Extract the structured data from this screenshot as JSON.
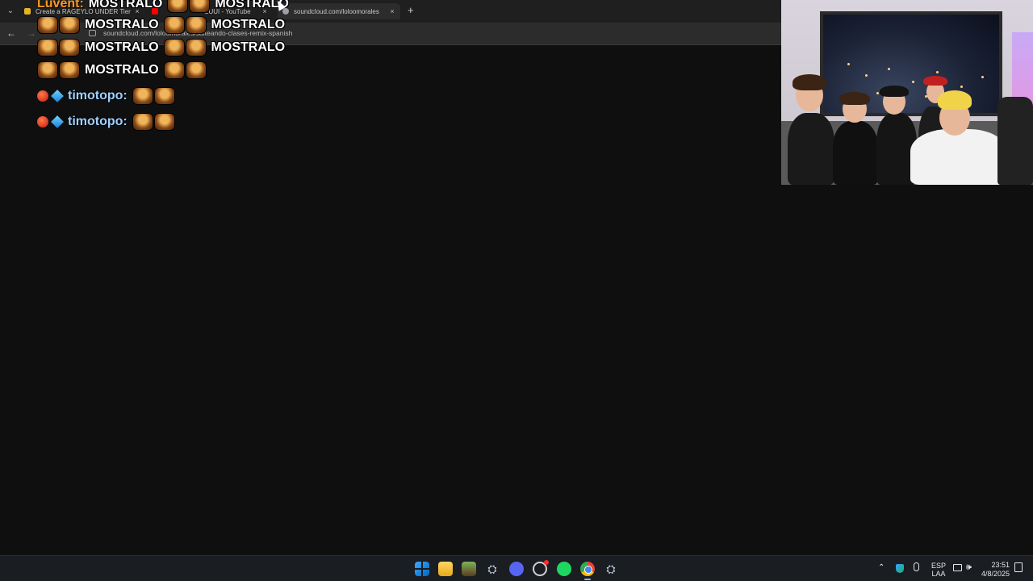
{
  "browser": {
    "tabs": [
      {
        "title": "Create a RAGEYLO UNDER Tier",
        "favicon_color": "#e6b422"
      },
      {
        "title": "2UUI - YouTube",
        "favicon_color": "#ff0000"
      },
      {
        "title": "soundcloud.com/loloomorales",
        "favicon_color": "#9aa0a6"
      }
    ],
    "new_tab_label": "+",
    "close_glyph": "×",
    "url": "soundcloud.com/loloomorales/salteando-clases-remix-spanish"
  },
  "chat": {
    "spam_user": "Luvent:",
    "spam_word": "MOSTRALO",
    "messages": [
      {
        "user": "timotopo:"
      },
      {
        "user": "timotopo:"
      }
    ]
  },
  "taskbar": {
    "language_top": "ESP",
    "language_bottom": "LAA",
    "time": "23:51",
    "date": "4/8/2025",
    "steam_glyph": "⛭"
  },
  "colors": {
    "username_color": "#9fd1ff",
    "spam_user_color": "#ff9a1f",
    "background": "#0f0f0f"
  }
}
